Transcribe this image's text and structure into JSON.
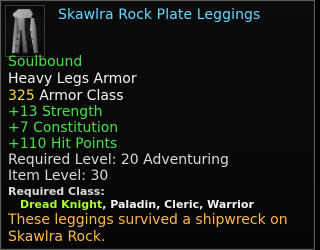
{
  "item": {
    "name": "Skawlra Rock Plate Leggings",
    "icon": "armor-leggings-icon",
    "binding": "Soulbound",
    "slot": "Heavy Legs Armor",
    "armor_class": {
      "value": "325",
      "label": "Armor Class"
    },
    "stats": [
      "+13 Strength",
      "+7 Constitution",
      "+110 Hit Points"
    ],
    "required_level": "Required Level: 20 Adventuring",
    "item_level": "Item Level: 30",
    "required_class": {
      "label": "Required Class:",
      "dread_knight": "Dread Knight",
      "others": ", Paladin, Cleric, Warrior"
    },
    "description": "These leggings survived a shipwreck on Skawlra Rock."
  },
  "colors": {
    "title": "#66d8ff",
    "soulbound": "#47e04a",
    "armor_class_value": "#ffd54a",
    "stat": "#47e04a",
    "dread_knight": "#a6ff2a",
    "description": "#ffb84d"
  }
}
